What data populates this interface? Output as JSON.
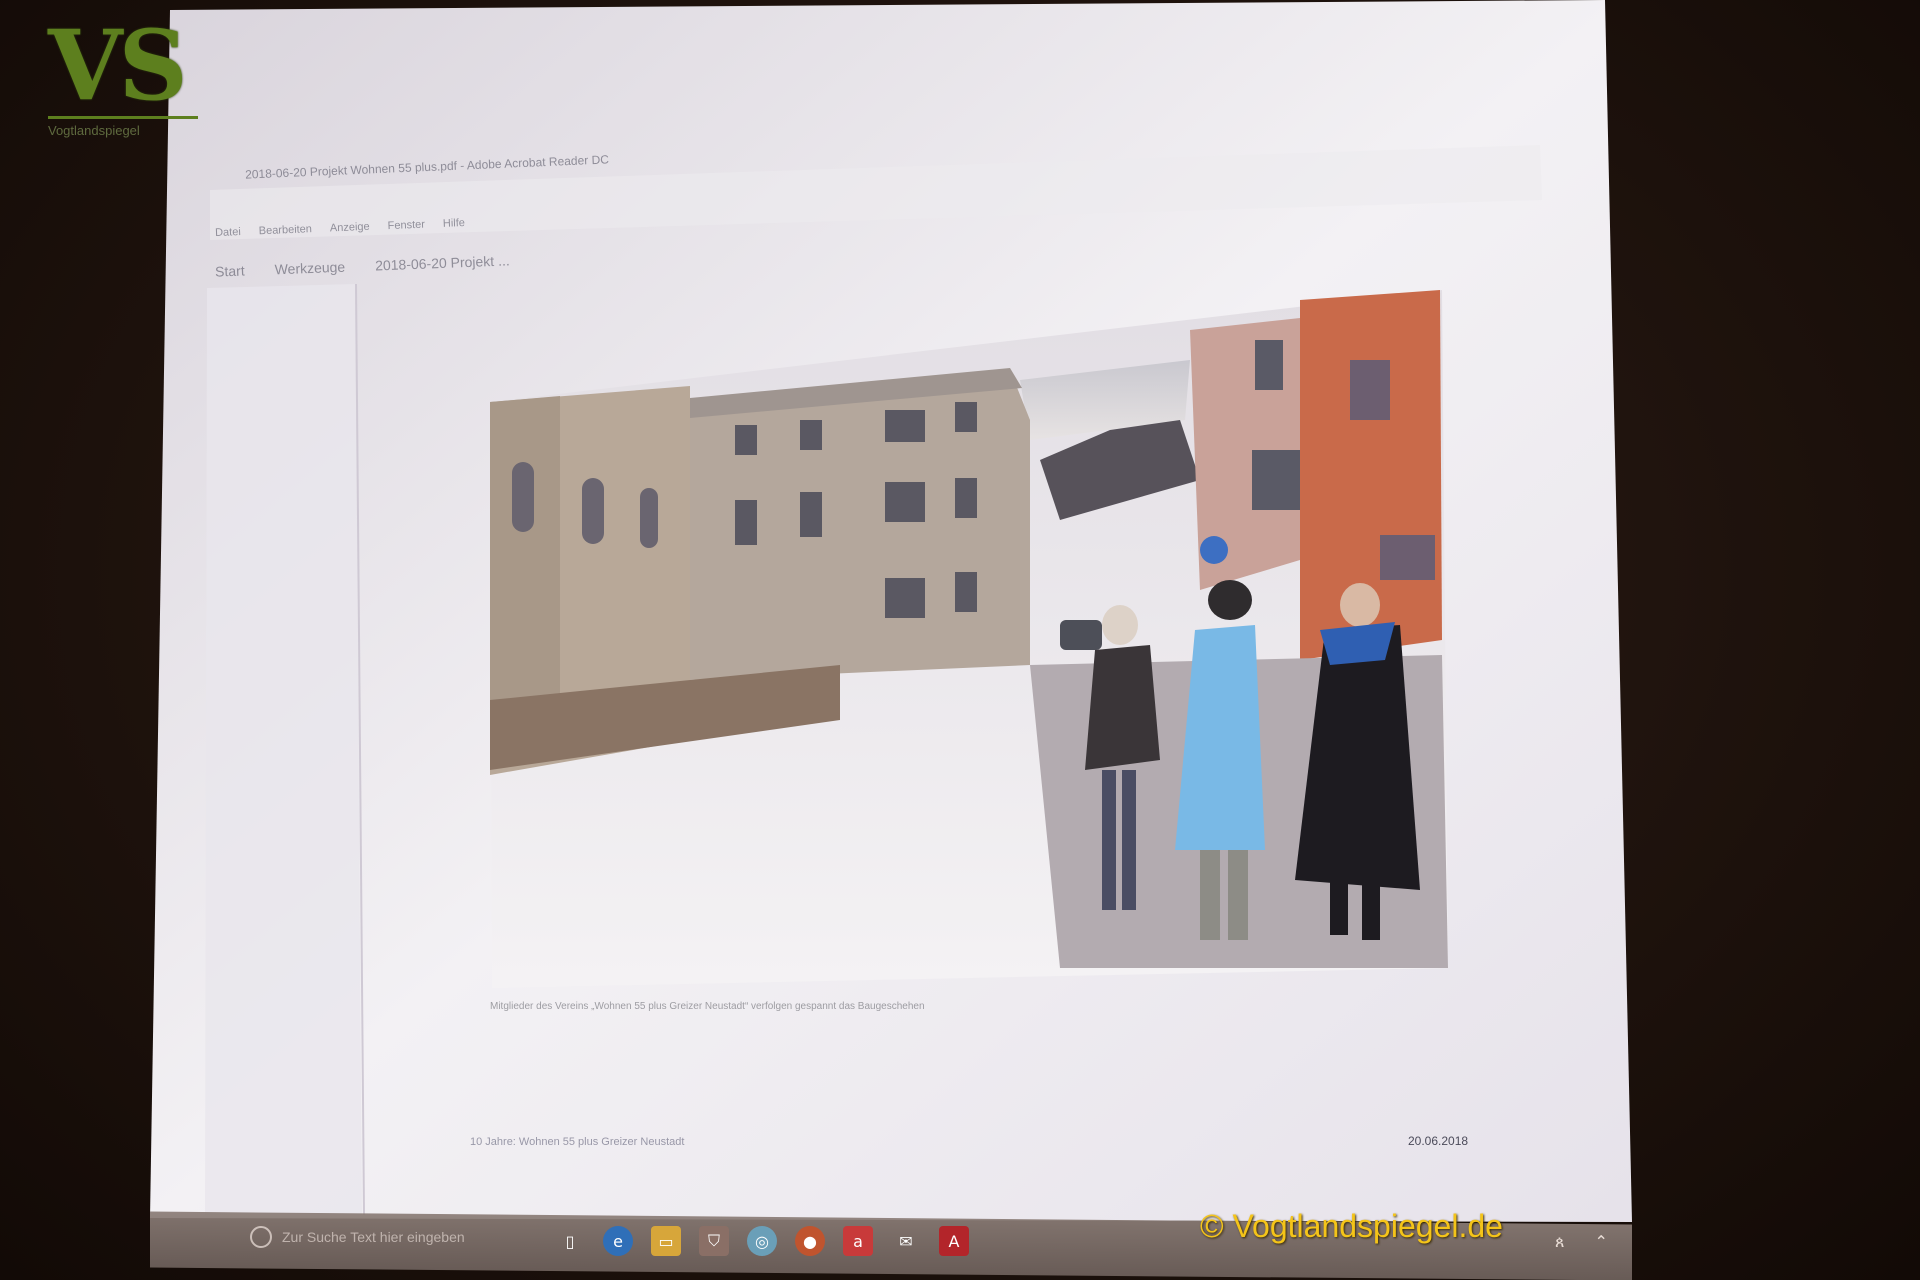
{
  "logo": {
    "mark": "VS",
    "subtitle": "Vogtlandspiegel"
  },
  "projected_window": {
    "title": "2018-06-20 Projekt Wohnen 55 plus.pdf - Adobe Acrobat Reader DC",
    "menu": [
      "Datei",
      "Bearbeiten",
      "Anzeige",
      "Fenster",
      "Hilfe"
    ],
    "tabs": [
      "Start",
      "Werkzeuge",
      "2018-06-20 Projekt ..."
    ]
  },
  "slide": {
    "caption": "Mitglieder des Vereins „Wohnen 55 plus Greizer Neustadt“ verfolgen gespannt das Baugeschehen",
    "footer_left": "10 Jahre: Wohnen 55 plus Greizer Neustadt",
    "footer_date": "20.06.2018"
  },
  "taskbar": {
    "search_placeholder": "Zur Suche Text hier eingeben",
    "icons": [
      "task-view-icon",
      "edge-icon",
      "file-explorer-icon",
      "store-icon",
      "app-icon",
      "firefox-icon",
      "avira-icon",
      "mail-icon",
      "acrobat-icon"
    ]
  },
  "watermark": "© Vogtlandspiegel.de"
}
